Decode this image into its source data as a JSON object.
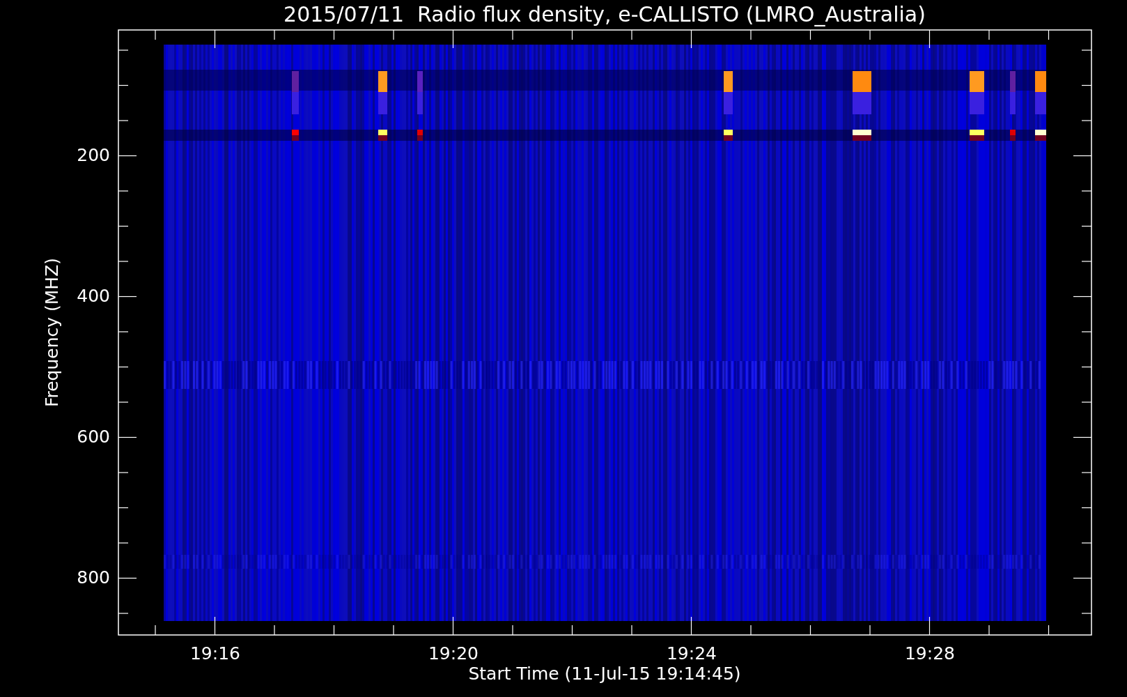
{
  "title": "2015/07/11  Radio flux density, e-CALLISTO (LMRO_Australia)",
  "ylabel": "Frequency (MHZ)",
  "xlabel": "Start Time (11-Jul-15 19:14:45)",
  "y_tick_labels": [
    "200",
    "400",
    "600",
    "800"
  ],
  "x_tick_labels": [
    "19:16",
    "19:20",
    "19:24",
    "19:28"
  ]
}
